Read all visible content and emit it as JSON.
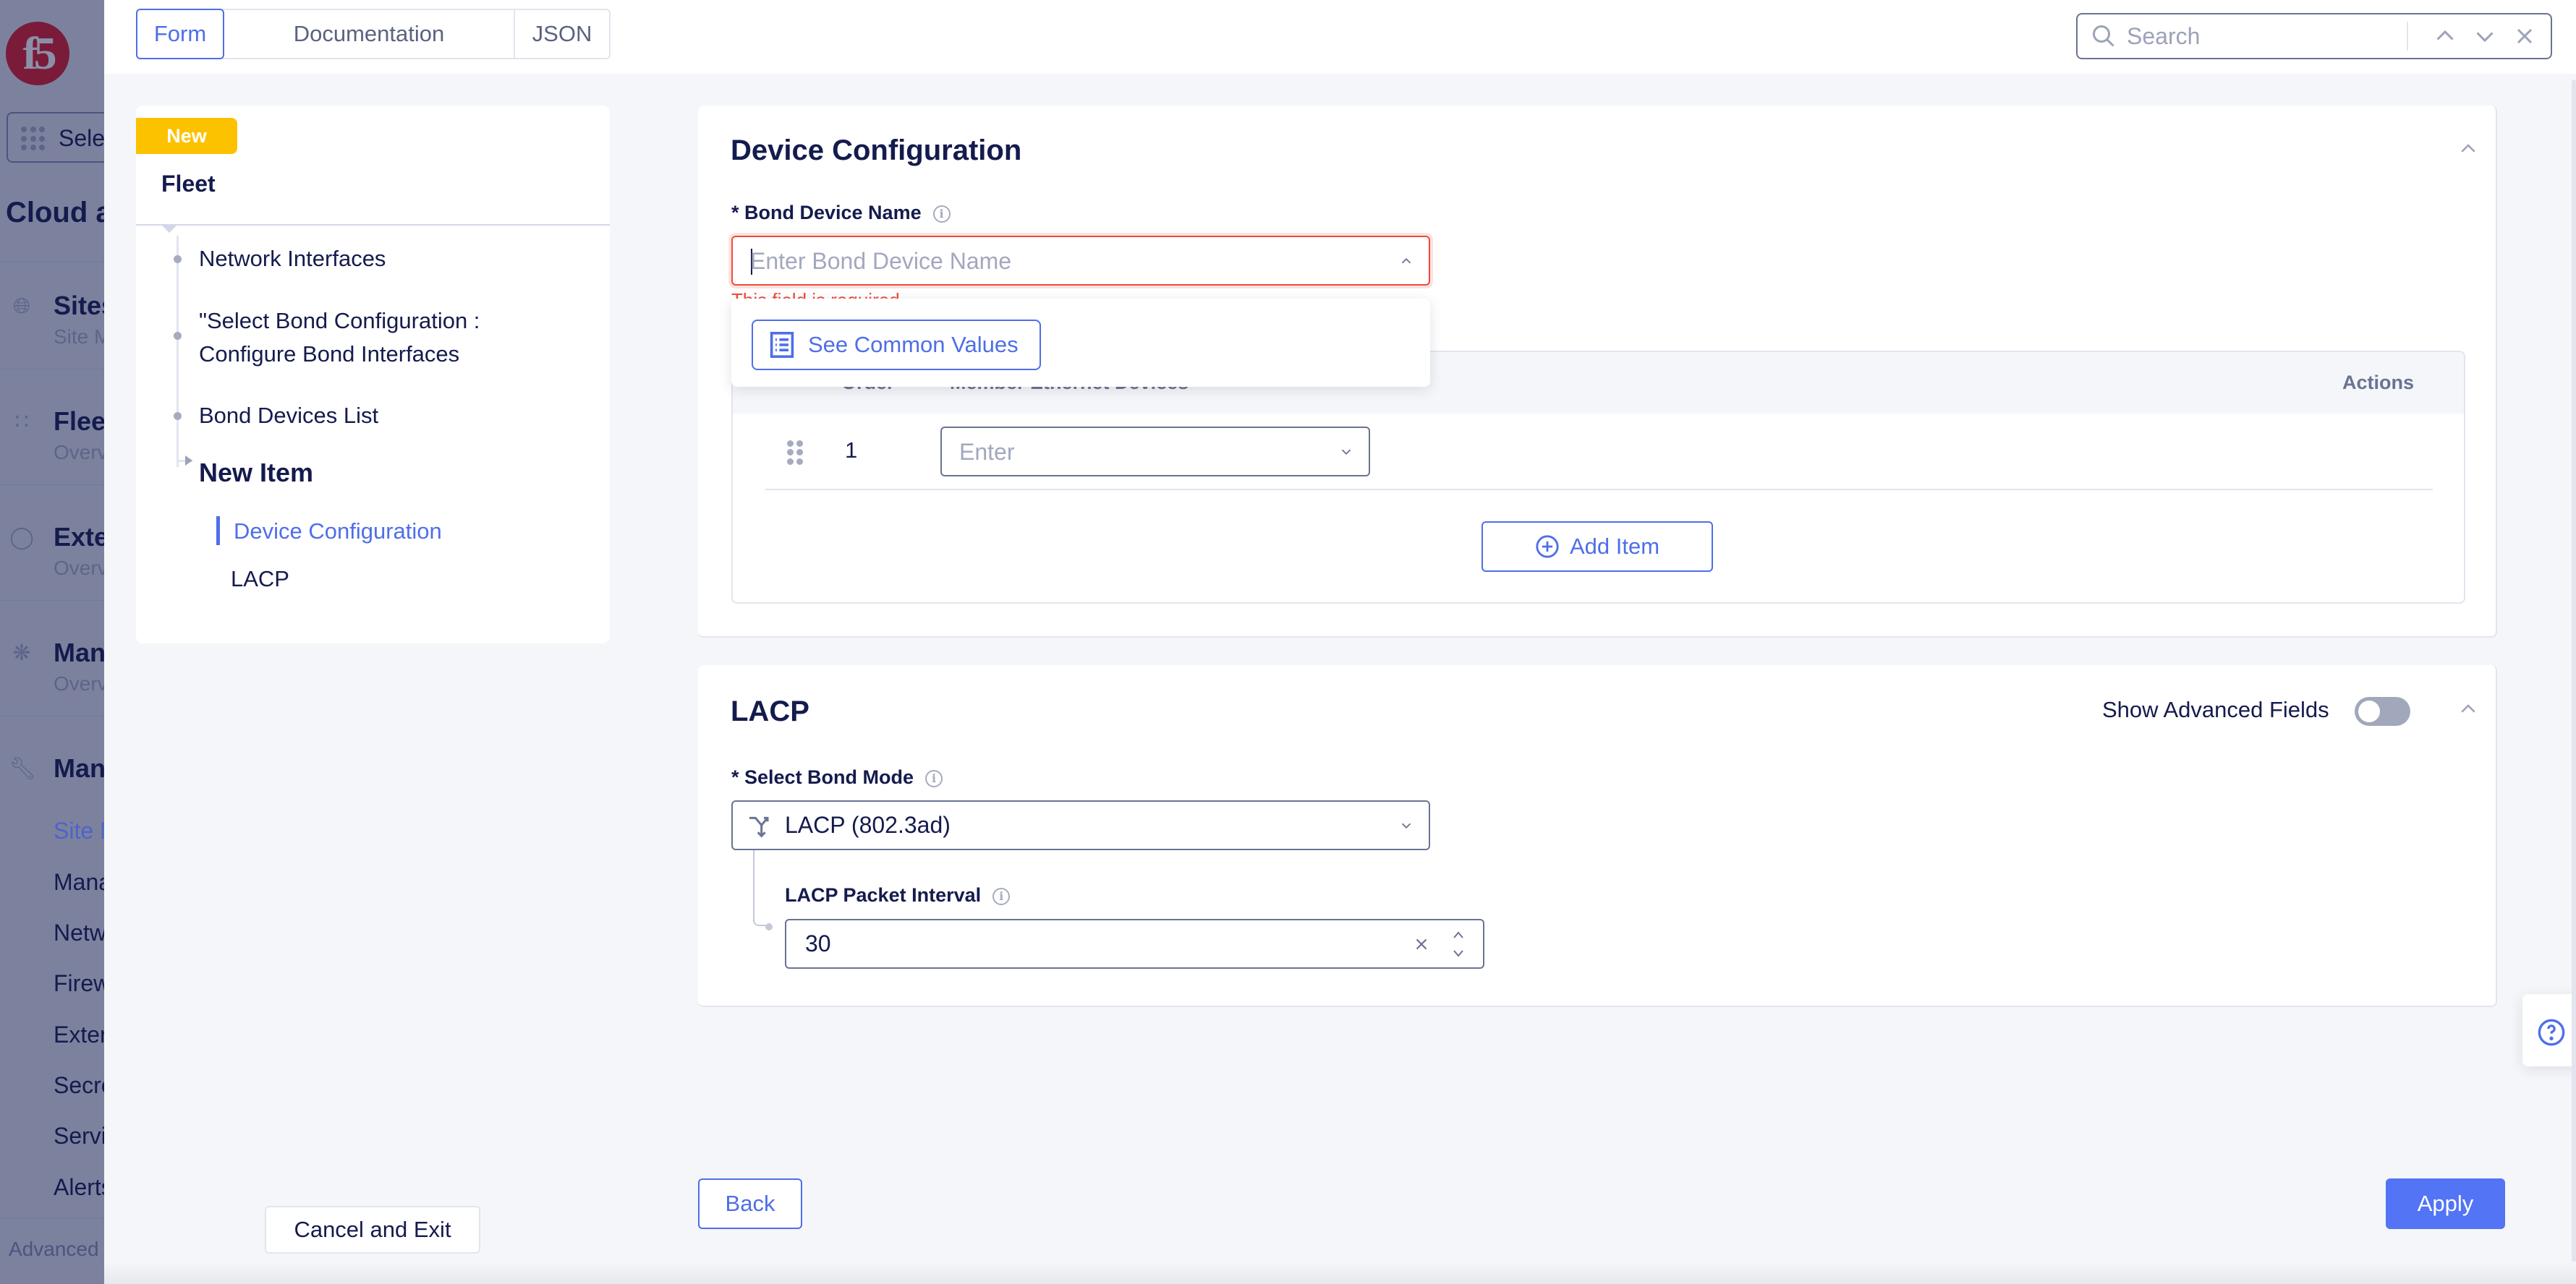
{
  "background_sidebar": {
    "logo": "f5",
    "workspace_select_label": "Select",
    "workspace_title": "Cloud and Edge Sites",
    "nav": [
      {
        "icon": "globe-icon",
        "title": "Sites",
        "subtitle": "Site Management"
      },
      {
        "icon": "fleet-icon",
        "title": "Fleet",
        "subtitle": "Overview"
      },
      {
        "icon": "shield-icon",
        "title": "External",
        "subtitle": "Overview"
      },
      {
        "icon": "gear-icon",
        "title": "Manage",
        "subtitle": "Overview"
      },
      {
        "icon": "wrench-icon",
        "title": "Manage",
        "subtitle": ""
      }
    ],
    "sub_items": [
      "Site Management",
      "Manage",
      "Networking",
      "Firewall",
      "External",
      "Secrets",
      "Services",
      "Alerts"
    ],
    "active_sub_index": 0,
    "advanced_label": "Advanced"
  },
  "topbar": {
    "tabs": [
      {
        "label": "Form",
        "active": true
      },
      {
        "label": "Documentation",
        "active": false
      },
      {
        "label": "JSON",
        "active": false
      }
    ],
    "search": {
      "placeholder": "Search",
      "value": ""
    }
  },
  "left_nav": {
    "badge": "New",
    "title": "Fleet",
    "items": [
      {
        "label": "Network Interfaces"
      },
      {
        "label_line1": "\"Select Bond Configuration :",
        "label_line2": "Configure Bond Interfaces"
      },
      {
        "label": "Bond Devices List"
      },
      {
        "label": "New Item",
        "current": true
      }
    ],
    "sub_items": [
      {
        "label": "Device Configuration",
        "active": true
      },
      {
        "label": "LACP",
        "active": false
      }
    ]
  },
  "device_configuration": {
    "title": "Device Configuration",
    "bond_device_name": {
      "label": "* Bond Device Name",
      "placeholder": "Enter Bond Device Name",
      "value": "",
      "error": "This field is required",
      "dropdown_open": true
    },
    "popup": {
      "see_common_values_label": "See Common Values"
    },
    "member_table": {
      "columns": [
        "Order",
        "Member Ethernet Devices",
        "Actions"
      ],
      "rows": [
        {
          "order": "1",
          "placeholder": "Enter",
          "value": ""
        }
      ],
      "add_item_label": "Add Item"
    }
  },
  "lacp": {
    "title": "LACP",
    "show_advanced_label": "Show Advanced Fields",
    "show_advanced_on": false,
    "bond_mode": {
      "label": "* Select Bond Mode",
      "value": "LACP (802.3ad)"
    },
    "packet_interval": {
      "label": "LACP Packet Interval",
      "value": "30"
    }
  },
  "footer": {
    "cancel_label": "Cancel and Exit",
    "back_label": "Back",
    "apply_label": "Apply"
  },
  "colors": {
    "accent": "#4f6ee8",
    "apply": "#5274f5",
    "error": "#ef4a3a",
    "badge": "#fcc200",
    "text": "#141b4d"
  }
}
